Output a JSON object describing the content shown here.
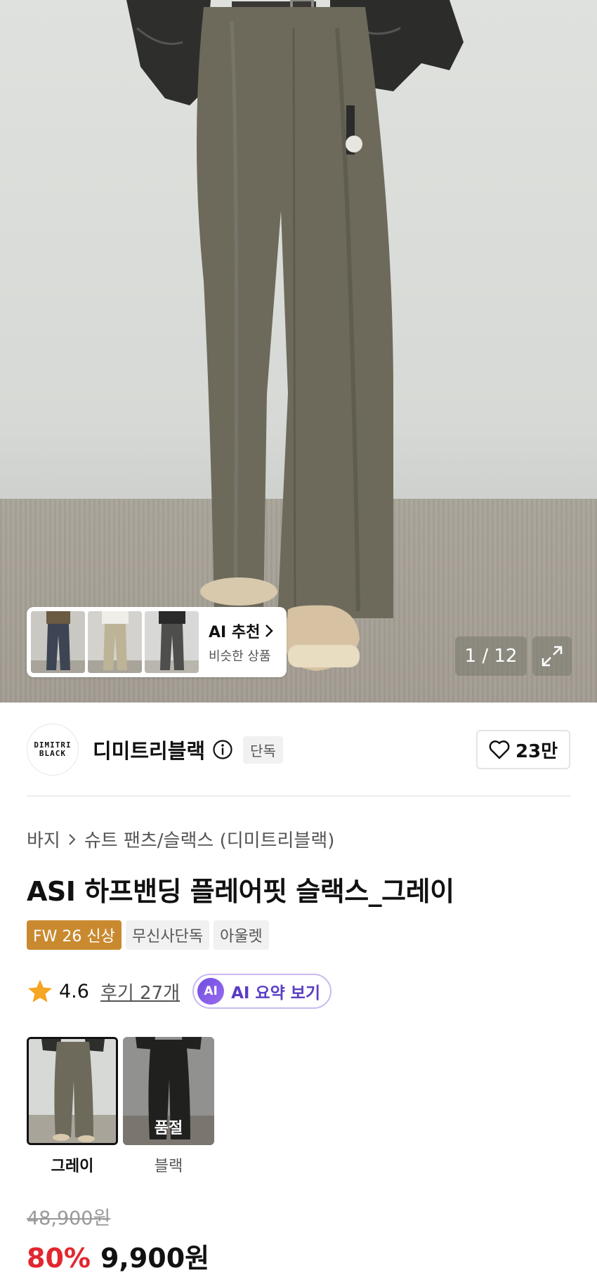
{
  "gallery": {
    "counter": "1 / 12",
    "ai_recommend": {
      "title": "AI 추천",
      "subtitle": "비슷한 상품"
    }
  },
  "brand": {
    "logo_line1": "DIMITRI",
    "logo_line2": "BLACK",
    "name": "디미트리블랙",
    "badge": "단독",
    "like_count": "23만"
  },
  "product": {
    "breadcrumb": [
      "바지",
      "슈트 팬츠/슬랙스 (디미트리블랙)"
    ],
    "title": "ASI 하프밴딩 플레어핏 슬랙스_그레이",
    "tags": [
      {
        "label": "FW 26 신상",
        "highlight": true
      },
      {
        "label": "무신사단독",
        "highlight": false
      },
      {
        "label": "아울렛",
        "highlight": false
      }
    ],
    "rating": "4.6",
    "reviews": "후기 27개",
    "ai_summary": {
      "badge": "AI",
      "label": "AI 요약 보기"
    }
  },
  "options": {
    "colors": [
      {
        "label": "그레이",
        "selected": true,
        "sold_out": false
      },
      {
        "label": "블랙",
        "selected": false,
        "sold_out": true,
        "sold_out_label": "품절"
      }
    ]
  },
  "price": {
    "original": "48,900원",
    "discount": "80%",
    "final": "9,900원"
  },
  "colors": {
    "accent_new": "#c98a2f",
    "discount_red": "#e3262f",
    "ai_purple": "#5b3cc4",
    "star": "#f5a623"
  }
}
